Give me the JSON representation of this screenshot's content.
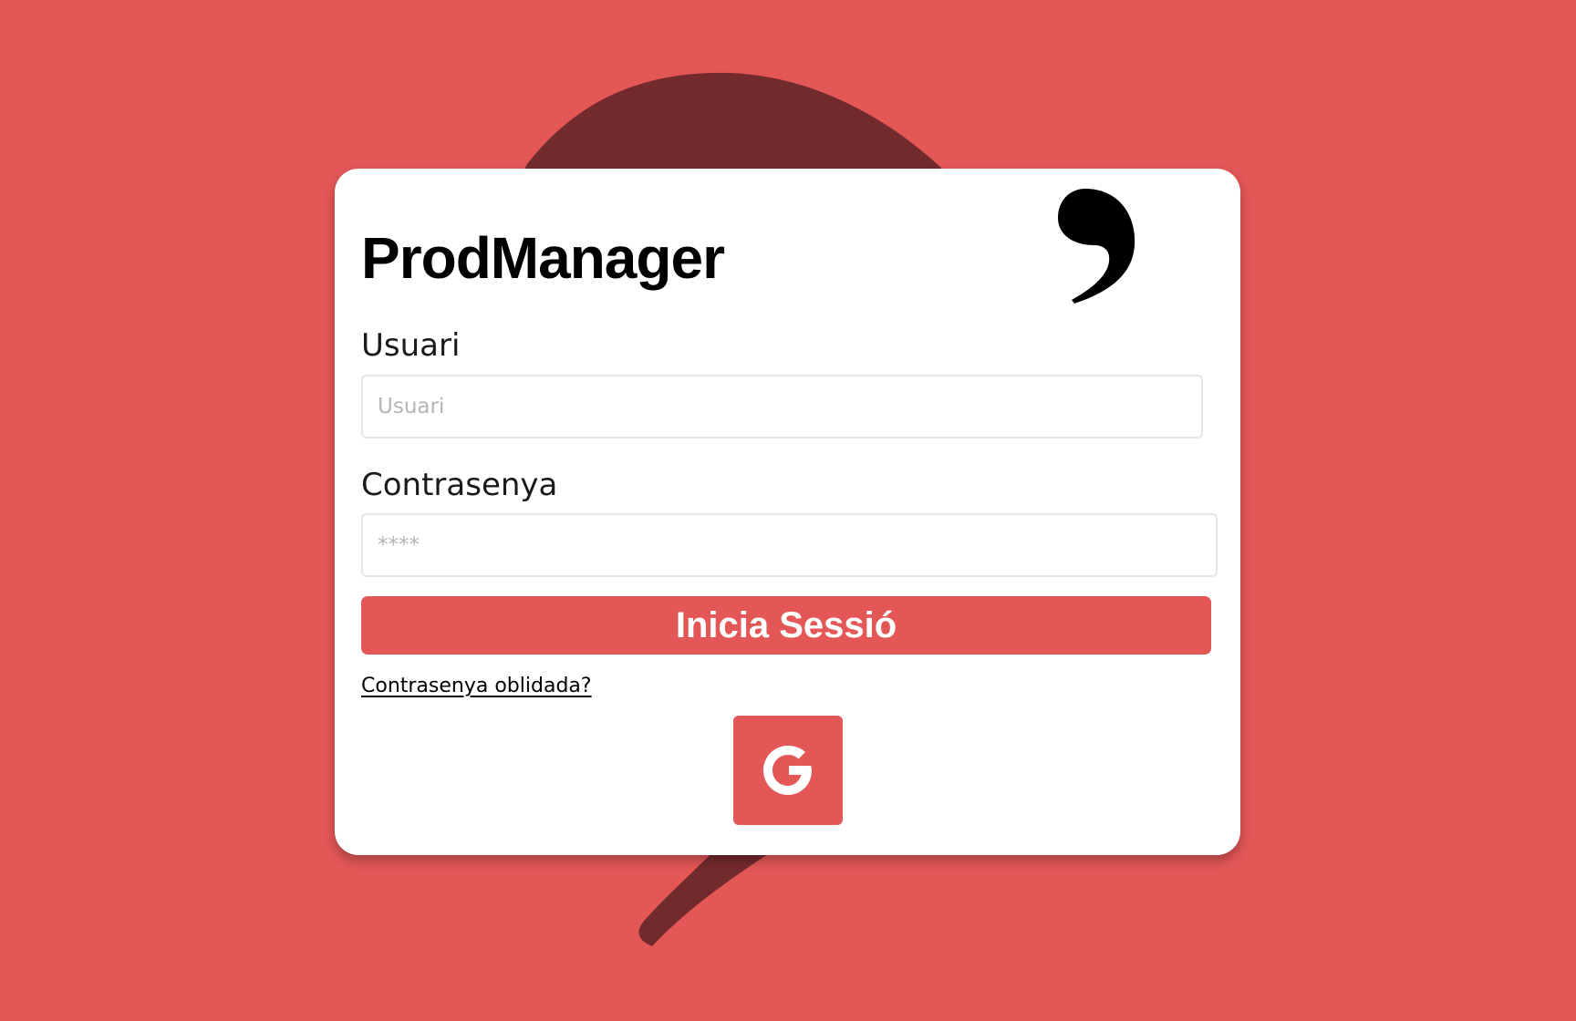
{
  "app": {
    "title": "ProdManager"
  },
  "form": {
    "username_label": "Usuari",
    "username_placeholder": "Usuari",
    "username_value": "",
    "password_label": "Contrasenya",
    "password_placeholder": "****",
    "password_value": "",
    "submit_label": "Inicia Sessió",
    "forgot_link": "Contrasenya oblidada?"
  },
  "social": {
    "google_icon": "google-g-icon"
  },
  "colors": {
    "accent": "#e35757",
    "comma_background": "#732a2d",
    "card": "#ffffff",
    "title_text": "#000000"
  }
}
